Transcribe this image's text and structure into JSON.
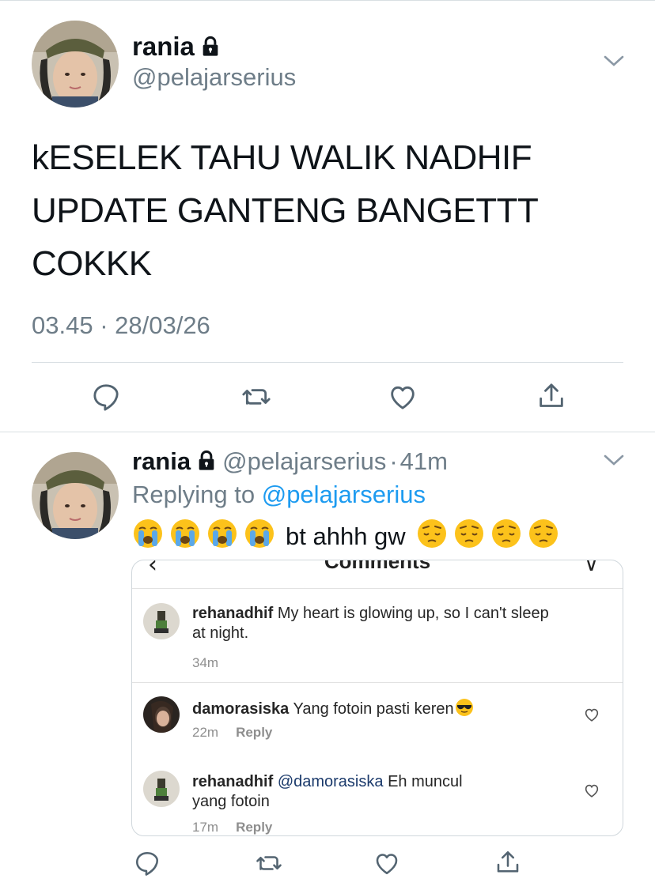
{
  "main_tweet": {
    "name": "rania",
    "handle": "@pelajarserius",
    "text_lines": [
      "kESELEK TAHU WALIK NADHIF",
      "UPDATE GANTENG BANGETTT",
      "COKKK"
    ],
    "timestamp": "03.45 · 28/03/26"
  },
  "reply_tweet": {
    "name": "rania",
    "handle": "@pelajarserius",
    "separator": "·",
    "age": "41m",
    "replying_prefix": "Replying to",
    "replying_to": "@pelajarserius",
    "text": "bt ahhh gw",
    "leading_emoji": [
      "loudly-crying-face",
      "loudly-crying-face",
      "loudly-crying-face",
      "loudly-crying-face"
    ],
    "trailing_emoji": [
      "pensive-face",
      "pensive-face",
      "pensive-face",
      "pensive-face"
    ]
  },
  "embed": {
    "header_title": "Comments",
    "comments": [
      {
        "user": "rehanadhif",
        "mention": "",
        "text": "My heart is glowing up, so I can't sleep",
        "text2": "at night.",
        "age": "34m",
        "reply_label": ""
      },
      {
        "user": "damorasiska",
        "mention": "",
        "text": "Yang fotoin pasti keren",
        "text2": "",
        "age": "22m",
        "reply_label": "Reply"
      },
      {
        "user": "rehanadhif",
        "mention": "@damorasiska",
        "text": "Eh muncul",
        "text2": "yang fotoin",
        "age": "17m",
        "reply_label": "Reply"
      }
    ]
  },
  "icons": [
    "lock-icon",
    "chevron-down-icon",
    "reply-icon",
    "retweet-icon",
    "like-icon",
    "share-icon",
    "heart-icon"
  ],
  "colors": {
    "text": "#0f1419",
    "secondary": "#6e7d88",
    "link": "#1d9bf0",
    "divider": "#d9dfe3"
  }
}
